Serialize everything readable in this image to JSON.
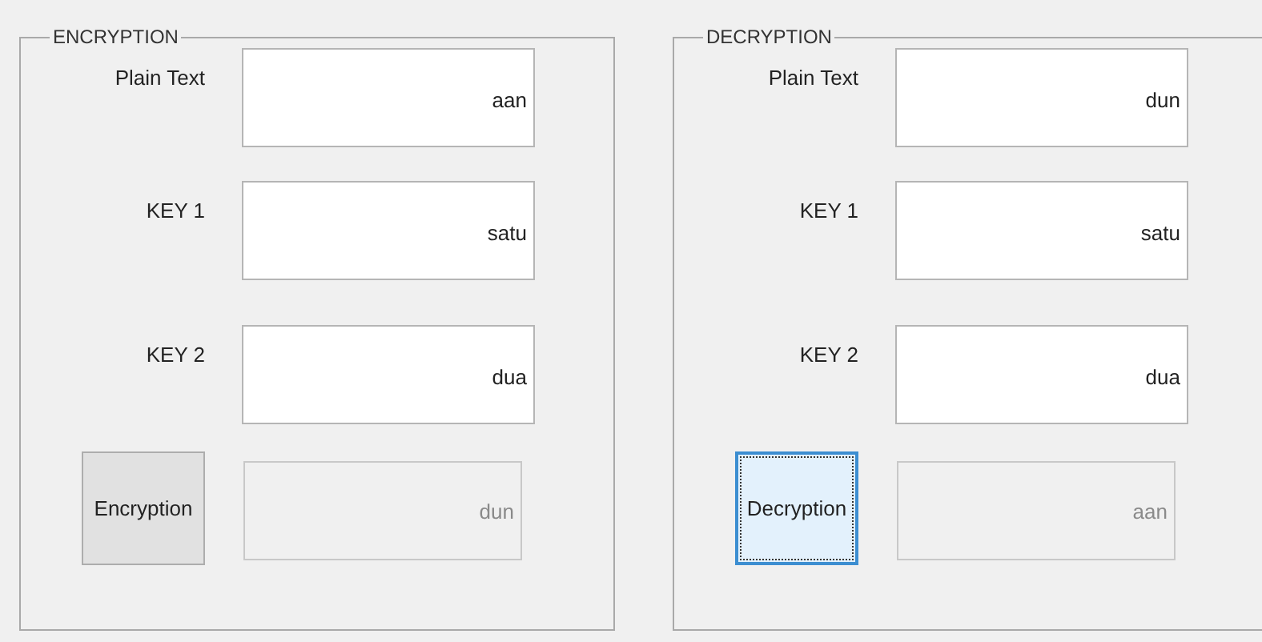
{
  "panels": [
    {
      "title": "ENCRYPTION",
      "fields": [
        {
          "label": "Plain Text",
          "value": "aan"
        },
        {
          "label": "KEY 1",
          "value": "satu"
        },
        {
          "label": "KEY 2",
          "value": "dua"
        }
      ],
      "button": {
        "label": "Encryption",
        "focused": false
      },
      "output": {
        "value": "dun",
        "disabled": true
      }
    },
    {
      "title": "DECRYPTION",
      "fields": [
        {
          "label": "Plain Text",
          "value": "dun"
        },
        {
          "label": "KEY 1",
          "value": "satu"
        },
        {
          "label": "KEY 2",
          "value": "dua"
        }
      ],
      "button": {
        "label": "Decryption",
        "focused": true
      },
      "output": {
        "value": "aan",
        "disabled": true
      }
    }
  ]
}
